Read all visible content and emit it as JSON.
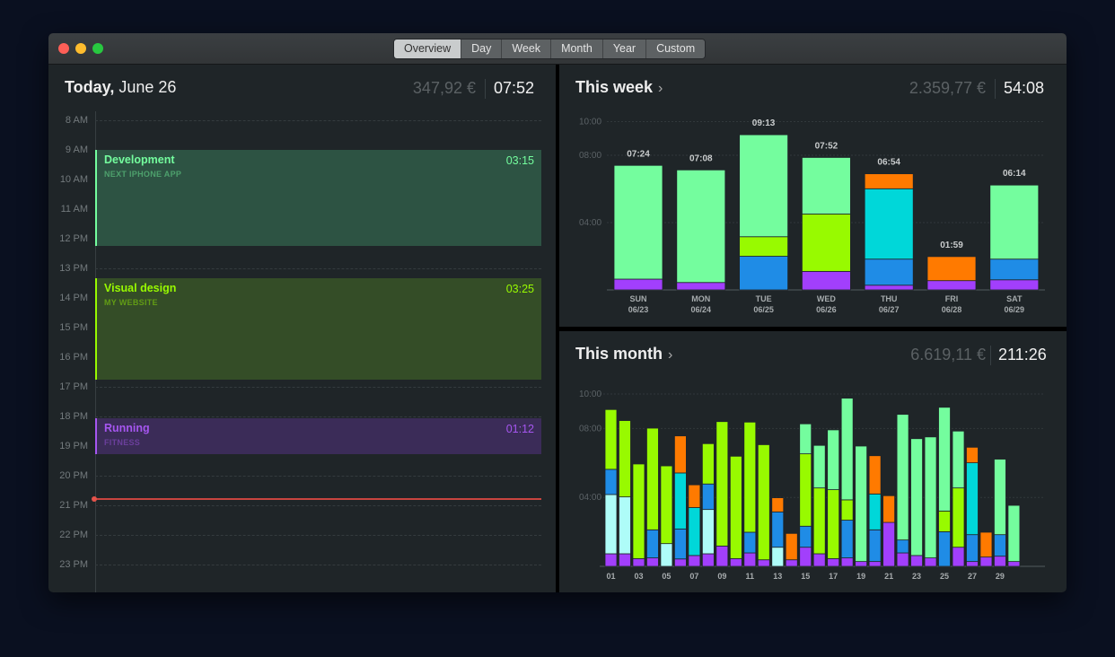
{
  "window": {
    "traffic_lights": {
      "close": "#fe5f57",
      "minimize": "#febc2e",
      "zoom": "#28c840"
    },
    "tabs": [
      {
        "label": "Overview",
        "active": true
      },
      {
        "label": "Day",
        "active": false
      },
      {
        "label": "Week",
        "active": false
      },
      {
        "label": "Month",
        "active": false
      },
      {
        "label": "Year",
        "active": false
      },
      {
        "label": "Custom",
        "active": false
      }
    ]
  },
  "colors": {
    "purple": "#a23ffc",
    "lightcyan": "#aefcf8",
    "blue": "#1f8ce6",
    "lime": "#98fa00",
    "mint": "#74fd9e",
    "cyan": "#00d7d9",
    "orange": "#ff7a00",
    "now_line": "#c8443f"
  },
  "today": {
    "title_bold": "Today,",
    "title_date": "June 26",
    "money": "347,92 €",
    "duration": "07:52",
    "hours": [
      "8 AM",
      "9 AM",
      "10 AM",
      "11 AM",
      "12 PM",
      "13 PM",
      "14 PM",
      "15 PM",
      "16 PM",
      "17 PM",
      "18 PM",
      "19 PM",
      "20 PM",
      "21 PM",
      "22 PM",
      "23 PM"
    ],
    "events": [
      {
        "name": "Development",
        "project": "NEXT IPHONE APP",
        "duration": "03:15",
        "start": 9.0,
        "end": 12.25,
        "color": "#74fd9e",
        "bg": "#2d5343"
      },
      {
        "name": "Visual design",
        "project": "MY WEBSITE",
        "duration": "03:25",
        "start": 13.33,
        "end": 16.75,
        "color": "#98fa00",
        "bg": "#344d27"
      },
      {
        "name": "Running",
        "project": "FITNESS",
        "duration": "01:12",
        "start": 18.07,
        "end": 19.27,
        "color": "#a656f0",
        "bg": "#3b2c58"
      }
    ],
    "now_hour": 20.79
  },
  "week": {
    "title": "This week",
    "chevron": "›",
    "money": "2.359,77 €",
    "duration": "54:08"
  },
  "month": {
    "title": "This month",
    "chevron": "›",
    "money": "6.619,11 €",
    "duration": "211:26"
  },
  "chart_data": [
    {
      "type": "bar",
      "stacked": true,
      "ylim": [
        0,
        10
      ],
      "yticks": [
        "04:00",
        "08:00",
        "10:00"
      ],
      "ytick_values": [
        4,
        8,
        10
      ],
      "grid": true,
      "unit": "hours",
      "categories": [
        {
          "day": "SUN",
          "date": "06/23",
          "total": "07:24",
          "segments": [
            [
              "purple",
              0.64
            ],
            [
              "mint",
              6.76
            ]
          ]
        },
        {
          "day": "MON",
          "date": "06/24",
          "total": "07:08",
          "segments": [
            [
              "purple",
              0.44
            ],
            [
              "mint",
              6.69
            ]
          ]
        },
        {
          "day": "TUE",
          "date": "06/25",
          "total": "09:13",
          "segments": [
            [
              "blue",
              2.0
            ],
            [
              "lime",
              1.16
            ],
            [
              "mint",
              6.06
            ]
          ]
        },
        {
          "day": "WED",
          "date": "06/26",
          "total": "07:52",
          "segments": [
            [
              "purple",
              1.1
            ],
            [
              "lime",
              3.41
            ],
            [
              "mint",
              3.36
            ]
          ]
        },
        {
          "day": "THU",
          "date": "06/27",
          "total": "06:54",
          "segments": [
            [
              "purple",
              0.28
            ],
            [
              "blue",
              1.55
            ],
            [
              "cyan",
              4.18
            ],
            [
              "orange",
              0.89
            ]
          ]
        },
        {
          "day": "FRI",
          "date": "06/28",
          "total": "01:59",
          "segments": [
            [
              "purple",
              0.55
            ],
            [
              "orange",
              1.43
            ]
          ]
        },
        {
          "day": "SAT",
          "date": "06/29",
          "total": "06:14",
          "segments": [
            [
              "purple",
              0.6
            ],
            [
              "blue",
              1.23
            ],
            [
              "mint",
              4.4
            ]
          ]
        }
      ]
    },
    {
      "type": "bar",
      "stacked": true,
      "ylim": [
        0,
        10
      ],
      "yticks": [
        "04:00",
        "08:00",
        "10:00"
      ],
      "ytick_values": [
        4,
        8,
        10
      ],
      "grid": true,
      "unit": "hours",
      "xtick_labels": [
        "01",
        "03",
        "05",
        "07",
        "09",
        "11",
        "13",
        "15",
        "17",
        "19",
        "21",
        "23",
        "25",
        "27",
        "29"
      ],
      "days": [
        [
          [
            "purple",
            0.73
          ],
          [
            "lightcyan",
            3.44
          ],
          [
            "blue",
            1.46
          ],
          [
            "lime",
            3.47
          ]
        ],
        [
          [
            "purple",
            0.73
          ],
          [
            "lightcyan",
            3.3
          ],
          [
            "lime",
            4.43
          ]
        ],
        [
          [
            "purple",
            0.45
          ],
          [
            "lime",
            5.49
          ]
        ],
        [
          [
            "purple",
            0.49
          ],
          [
            "blue",
            1.63
          ],
          [
            "lime",
            5.9
          ]
        ],
        [
          [
            "lightcyan",
            1.32
          ],
          [
            "lime",
            4.51
          ]
        ],
        [
          [
            "purple",
            0.43
          ],
          [
            "blue",
            1.74
          ],
          [
            "cyan",
            3.25
          ],
          [
            "orange",
            2.15
          ]
        ],
        [
          [
            "purple",
            0.63
          ],
          [
            "cyan",
            2.78
          ],
          [
            "orange",
            1.32
          ]
        ],
        [
          [
            "purple",
            0.73
          ],
          [
            "lightcyan",
            2.57
          ],
          [
            "blue",
            1.48
          ],
          [
            "lime",
            2.34
          ]
        ],
        [
          [
            "purple",
            1.18
          ],
          [
            "lime",
            7.22
          ]
        ],
        [
          [
            "purple",
            0.45
          ],
          [
            "lime",
            5.94
          ]
        ],
        [
          [
            "purple",
            0.78
          ],
          [
            "blue",
            1.2
          ],
          [
            "lime",
            6.39
          ]
        ],
        [
          [
            "purple",
            0.38
          ],
          [
            "lime",
            6.68
          ]
        ],
        [
          [
            "lightcyan",
            1.11
          ],
          [
            "blue",
            2.05
          ],
          [
            "orange",
            0.82
          ]
        ],
        [
          [
            "purple",
            0.38
          ],
          [
            "orange",
            1.53
          ]
        ],
        [
          [
            "purple",
            1.11
          ],
          [
            "blue",
            1.22
          ],
          [
            "lime",
            4.2
          ],
          [
            "mint",
            1.74
          ]
        ],
        [
          [
            "purple",
            0.73
          ],
          [
            "lime",
            3.82
          ],
          [
            "mint",
            2.47
          ]
        ],
        [
          [
            "purple",
            0.45
          ],
          [
            "lime",
            4.0
          ],
          [
            "mint",
            3.47
          ]
        ],
        [
          [
            "purple",
            0.49
          ],
          [
            "blue",
            2.19
          ],
          [
            "lime",
            1.18
          ],
          [
            "mint",
            5.9
          ]
        ],
        [
          [
            "purple",
            0.28
          ],
          [
            "mint",
            6.7
          ]
        ],
        [
          [
            "purple",
            0.28
          ],
          [
            "blue",
            1.84
          ],
          [
            "cyan",
            2.08
          ],
          [
            "orange",
            2.22
          ]
        ],
        [
          [
            "purple",
            2.55
          ],
          [
            "orange",
            1.55
          ]
        ],
        [
          [
            "purple",
            0.78
          ],
          [
            "blue",
            0.75
          ],
          [
            "mint",
            7.29
          ]
        ],
        [
          [
            "purple",
            0.63
          ],
          [
            "mint",
            6.78
          ]
        ],
        [
          [
            "purple",
            0.49
          ],
          [
            "mint",
            7.02
          ]
        ],
        [
          [
            "blue",
            2.01
          ],
          [
            "lime",
            1.2
          ],
          [
            "mint",
            6.02
          ]
        ],
        [
          [
            "purple",
            1.11
          ],
          [
            "lime",
            3.44
          ],
          [
            "mint",
            3.3
          ]
        ],
        [
          [
            "purple",
            0.28
          ],
          [
            "blue",
            1.56
          ],
          [
            "cyan",
            4.17
          ],
          [
            "orange",
            0.9
          ]
        ],
        [
          [
            "purple",
            0.54
          ],
          [
            "orange",
            1.44
          ]
        ],
        [
          [
            "purple",
            0.59
          ],
          [
            "blue",
            1.25
          ],
          [
            "mint",
            4.38
          ]
        ],
        [
          [
            "purple",
            0.28
          ],
          [
            "mint",
            3.26
          ]
        ]
      ]
    }
  ]
}
